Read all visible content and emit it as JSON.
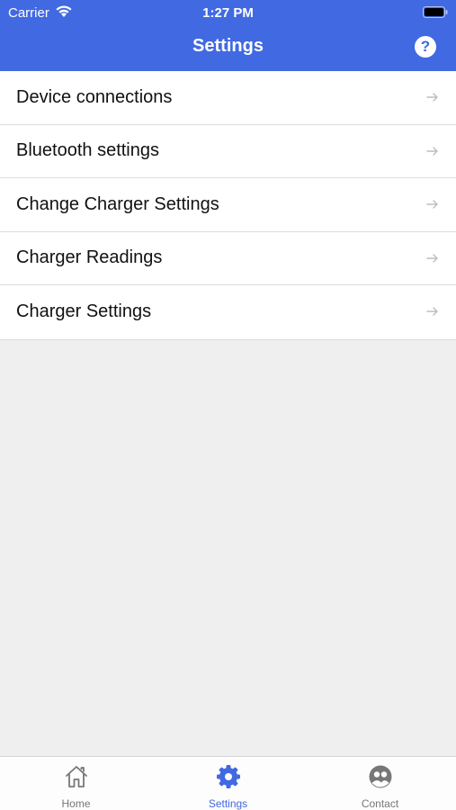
{
  "status_bar": {
    "carrier": "Carrier",
    "time": "1:27 PM"
  },
  "header": {
    "title": "Settings",
    "help_label": "?"
  },
  "menu": {
    "items": [
      {
        "label": "Device connections"
      },
      {
        "label": "Bluetooth settings"
      },
      {
        "label": "Change Charger Settings"
      },
      {
        "label": "Charger Readings"
      },
      {
        "label": "Charger Settings"
      }
    ]
  },
  "tabbar": {
    "items": [
      {
        "label": "Home",
        "icon": "home-icon"
      },
      {
        "label": "Settings",
        "icon": "gear-icon",
        "active": true
      },
      {
        "label": "Contact",
        "icon": "contact-icon"
      }
    ]
  },
  "colors": {
    "accent": "#4169e1",
    "background": "#efefef",
    "tab_inactive": "#777777"
  }
}
